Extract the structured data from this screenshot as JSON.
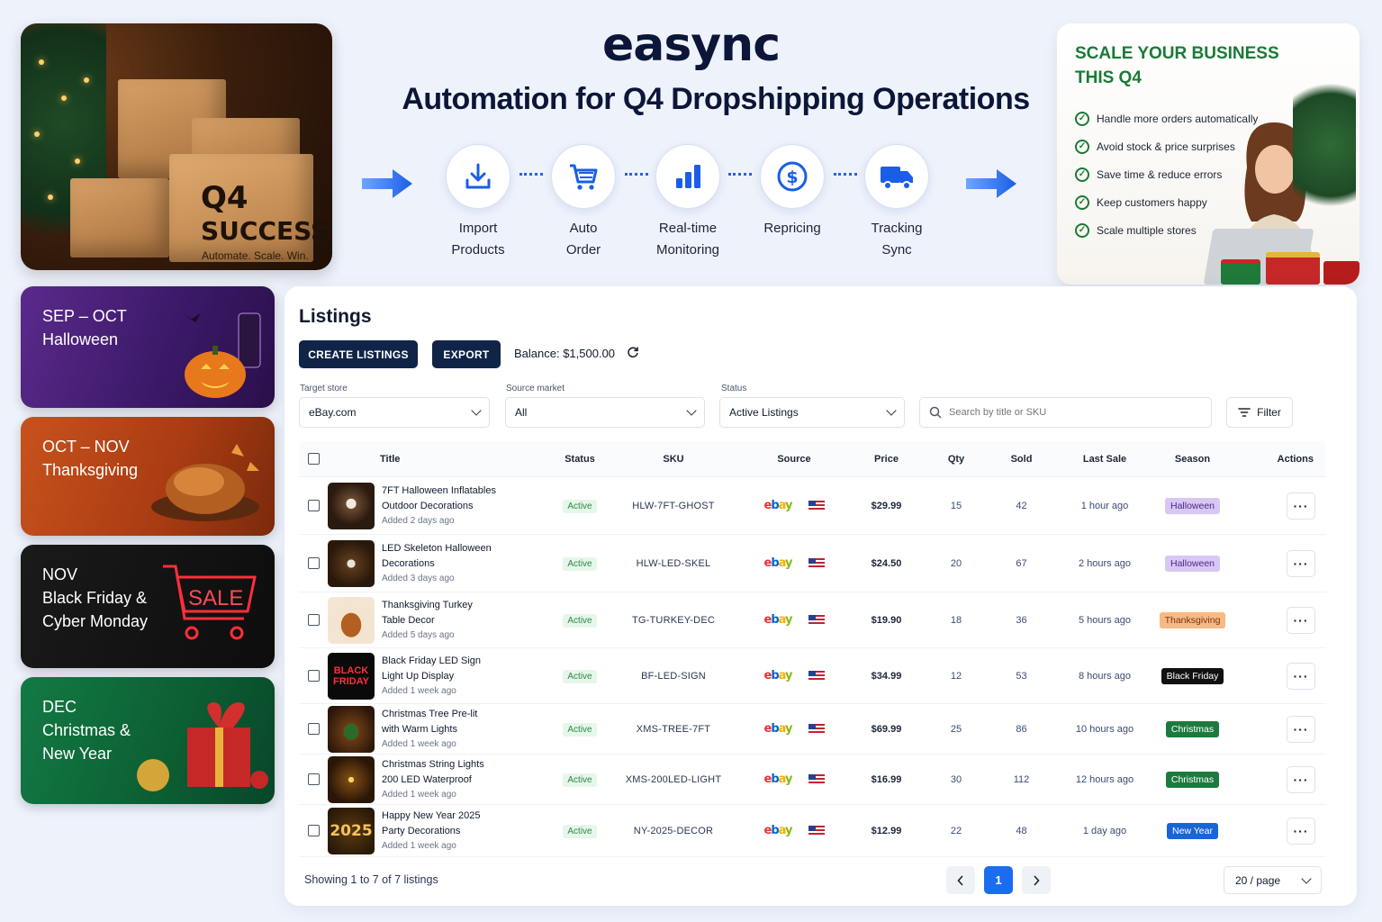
{
  "brand": "easync",
  "headline": "Automation for Q4 Dropshipping Operations",
  "hero": {
    "q4": "Q4",
    "success": "SUCCESS",
    "tagline": "Automate. Scale. Win."
  },
  "flow_steps": [
    {
      "line1": "Import",
      "line2": "Products",
      "icon": "download-icon"
    },
    {
      "line1": "Auto",
      "line2": "Order",
      "icon": "cart-icon"
    },
    {
      "line1": "Real-time",
      "line2": "Monitoring",
      "icon": "bar-chart-icon"
    },
    {
      "line1": "Repricing",
      "line2": "",
      "icon": "dollar-icon"
    },
    {
      "line1": "Tracking",
      "line2": "Sync",
      "icon": "truck-icon"
    }
  ],
  "promo": {
    "title": "SCALE YOUR BUSINESS THIS Q4",
    "items": [
      "Handle more orders automatically",
      "Avoid stock & price surprises",
      "Save time & reduce errors",
      "Keep customers happy",
      "Scale multiple stores"
    ]
  },
  "seasons": [
    {
      "period": "SEP – OCT",
      "name1": "Halloween",
      "name2": "",
      "color": "#4b1f7a"
    },
    {
      "period": "OCT – NOV",
      "name1": "Thanksgiving",
      "name2": "",
      "color": "#b9461a"
    },
    {
      "period": "NOV",
      "name1": "Black Friday &",
      "name2": "Cyber Monday",
      "sale": "SALE",
      "color": "#111111"
    },
    {
      "period": "DEC",
      "name1": "Christmas &",
      "name2": "New Year",
      "color": "#0f6a3a"
    }
  ],
  "listings": {
    "title": "Listings",
    "create_label": "CREATE LISTINGS",
    "export_label": "EXPORT",
    "balance": "Balance: $1,500.00",
    "filters": {
      "target_store_label": "Target store",
      "target_store_value": "eBay.com",
      "source_market_label": "Source market",
      "source_market_value": "All",
      "status_label": "Status",
      "status_value": "Active Listings",
      "search_placeholder": "Search by title or SKU",
      "filter_label": "Filter"
    },
    "columns": [
      "Title",
      "Status",
      "SKU",
      "Source",
      "Price",
      "Qty",
      "Sold",
      "Last Sale",
      "Season",
      "Actions"
    ],
    "rows": [
      {
        "title1": "7FT Halloween Inflatables",
        "title2": "Outdoor Decorations",
        "added": "Added 2 days ago",
        "status": "Active",
        "sku": "HLW-7FT-GHOST",
        "source": "ebay",
        "price": "$29.99",
        "qty": "15",
        "sold": "42",
        "last_sale": "1 hour ago",
        "season": "Halloween",
        "season_bg": "#d9c7f3",
        "season_fg": "#4a2785",
        "thumb": "ghost"
      },
      {
        "title1": "LED Skeleton Halloween",
        "title2": "Decorations",
        "added": "Added 3 days ago",
        "status": "Active",
        "sku": "HLW-LED-SKEL",
        "source": "ebay",
        "price": "$24.50",
        "qty": "20",
        "sold": "67",
        "last_sale": "2 hours ago",
        "season": "Halloween",
        "season_bg": "#d9c7f3",
        "season_fg": "#4a2785",
        "thumb": "skeleton"
      },
      {
        "title1": "Thanksgiving Turkey",
        "title2": "Table Decor",
        "added": "Added 5 days ago",
        "status": "Active",
        "sku": "TG-TURKEY-DEC",
        "source": "ebay",
        "price": "$19.90",
        "qty": "18",
        "sold": "36",
        "last_sale": "5 hours ago",
        "season": "Thanksgiving",
        "season_bg": "#f7b985",
        "season_fg": "#7a3410",
        "thumb": "turkey"
      },
      {
        "title1": "Black Friday LED Sign",
        "title2": "Light Up Display",
        "added": "Added 1 week ago",
        "status": "Active",
        "sku": "BF-LED-SIGN",
        "source": "ebay",
        "price": "$34.99",
        "qty": "12",
        "sold": "53",
        "last_sale": "8 hours ago",
        "season": "Black Friday",
        "season_bg": "#111111",
        "season_fg": "#ffffff",
        "thumb": "bf",
        "thumb_text1": "BLACK",
        "thumb_text2": "FRIDAY"
      },
      {
        "title1": "Christmas Tree Pre-lit",
        "title2": "with Warm Lights",
        "added": "Added 1 week ago",
        "status": "Active",
        "sku": "XMS-TREE-7FT",
        "source": "ebay",
        "price": "$69.99",
        "qty": "25",
        "sold": "86",
        "last_sale": "10 hours ago",
        "season": "Christmas",
        "season_bg": "#1d7a3e",
        "season_fg": "#ffffff",
        "thumb": "tree"
      },
      {
        "title1": "Christmas String Lights",
        "title2": "200 LED Waterproof",
        "added": "Added 1 week ago",
        "status": "Active",
        "sku": "XMS-200LED-LIGHT",
        "source": "ebay",
        "price": "$16.99",
        "qty": "30",
        "sold": "112",
        "last_sale": "12 hours ago",
        "season": "Christmas",
        "season_bg": "#1d7a3e",
        "season_fg": "#ffffff",
        "thumb": "lights"
      },
      {
        "title1": "Happy New Year 2025",
        "title2": "Party Decorations",
        "added": "Added 1 week ago",
        "status": "Active",
        "sku": "NY-2025-DECOR",
        "source": "ebay",
        "price": "$12.99",
        "qty": "22",
        "sold": "48",
        "last_sale": "1 day ago",
        "season": "New Year",
        "season_bg": "#1864d8",
        "season_fg": "#ffffff",
        "thumb": "ny",
        "thumb_text1": "2025"
      }
    ],
    "footer": {
      "showing": "Showing 1 to 7 of 7 listings",
      "page": "1",
      "per_page": "20 / page"
    }
  },
  "colors": {
    "accent": "#1a6cf0",
    "navy": "#0f2447",
    "green": "#1a7a35"
  }
}
